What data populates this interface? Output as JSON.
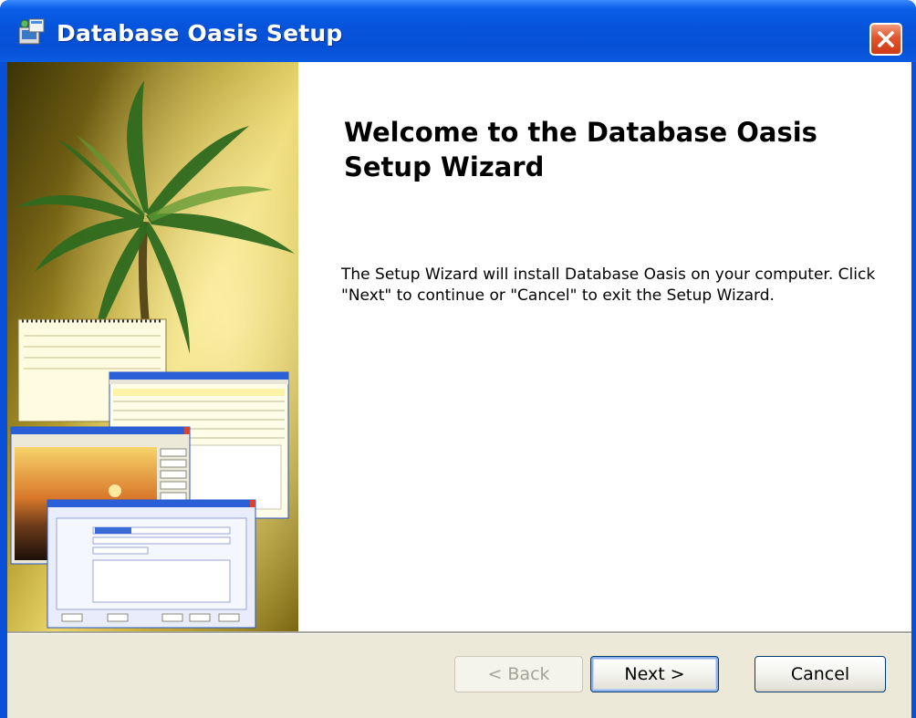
{
  "window": {
    "title": "Database Oasis Setup",
    "close_icon": "close-icon"
  },
  "side_panel": {
    "image": "palm-tree-and-app-screenshots-illustration"
  },
  "main": {
    "heading": "Welcome to the Database Oasis Setup Wizard",
    "description": "The Setup Wizard will install Database Oasis on your computer.  Click \"Next\" to continue or \"Cancel\" to exit the Setup Wizard."
  },
  "buttons": {
    "back_label": "< Back",
    "next_label": "Next >",
    "cancel_label": "Cancel"
  },
  "colors": {
    "title_bar": "#0755dd",
    "close_button": "#e0552d",
    "button_bar": "#ece9d8"
  }
}
